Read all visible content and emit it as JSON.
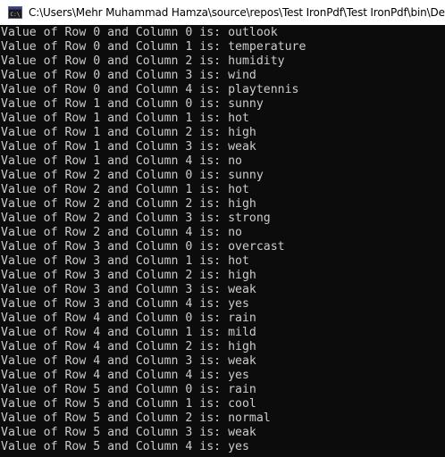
{
  "window": {
    "title": "C:\\Users\\Mehr Muhammad Hamza\\source\\repos\\Test IronPdf\\Test IronPdf\\bin\\Debug\\n",
    "icon": "console-app-icon"
  },
  "console": {
    "lines": [
      "Value of Row 0 and Column 0 is: outlook",
      "Value of Row 0 and Column 1 is: temperature",
      "Value of Row 0 and Column 2 is: humidity",
      "Value of Row 0 and Column 3 is: wind",
      "Value of Row 0 and Column 4 is: playtennis",
      "Value of Row 1 and Column 0 is: sunny",
      "Value of Row 1 and Column 1 is: hot",
      "Value of Row 1 and Column 2 is: high",
      "Value of Row 1 and Column 3 is: weak",
      "Value of Row 1 and Column 4 is: no",
      "Value of Row 2 and Column 0 is: sunny",
      "Value of Row 2 and Column 1 is: hot",
      "Value of Row 2 and Column 2 is: high",
      "Value of Row 2 and Column 3 is: strong",
      "Value of Row 2 and Column 4 is: no",
      "Value of Row 3 and Column 0 is: overcast",
      "Value of Row 3 and Column 1 is: hot",
      "Value of Row 3 and Column 2 is: high",
      "Value of Row 3 and Column 3 is: weak",
      "Value of Row 3 and Column 4 is: yes",
      "Value of Row 4 and Column 0 is: rain",
      "Value of Row 4 and Column 1 is: mild",
      "Value of Row 4 and Column 2 is: high",
      "Value of Row 4 and Column 3 is: weak",
      "Value of Row 4 and Column 4 is: yes",
      "Value of Row 5 and Column 0 is: rain",
      "Value of Row 5 and Column 1 is: cool",
      "Value of Row 5 and Column 2 is: normal",
      "Value of Row 5 and Column 3 is: weak",
      "Value of Row 5 and Column 4 is: yes"
    ]
  },
  "colors": {
    "background": "#0c0c0c",
    "text": "#cccccc",
    "titlebar": "#ffffff"
  }
}
